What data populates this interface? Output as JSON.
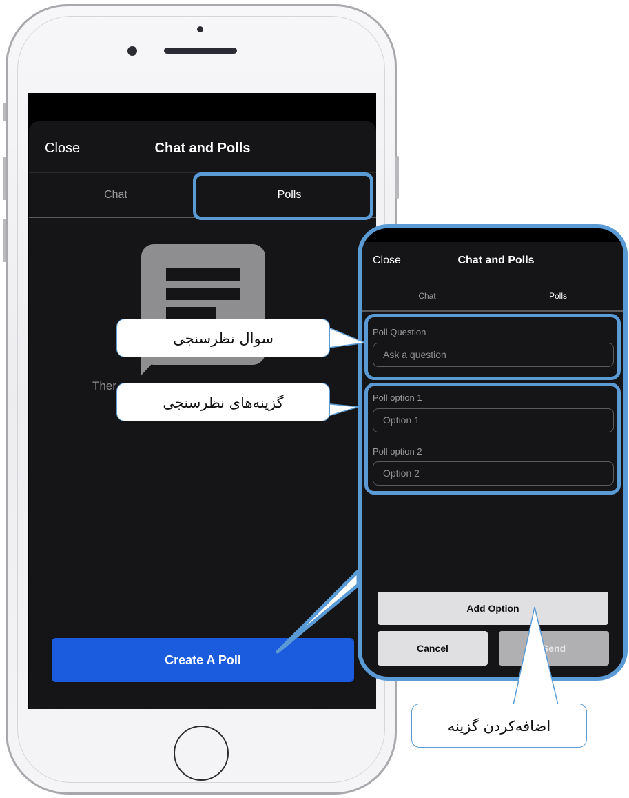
{
  "screen": {
    "header": {
      "close_label": "Close",
      "title": "Chat and Polls"
    },
    "tabs": [
      {
        "label": "Chat"
      },
      {
        "label": "Polls"
      }
    ],
    "empty_state": {
      "text_fragment": "Ther"
    },
    "create_poll_label": "Create A Poll"
  },
  "zoom": {
    "header": {
      "close_label": "Close",
      "title": "Chat and Polls"
    },
    "tabs": [
      {
        "label": "Chat"
      },
      {
        "label": "Polls"
      }
    ],
    "poll_question": {
      "label": "Poll Question",
      "placeholder": "Ask a question"
    },
    "options": [
      {
        "label": "Poll option 1",
        "placeholder": "Option 1"
      },
      {
        "label": "Poll option 2",
        "placeholder": "Option 2"
      }
    ],
    "buttons": {
      "add_option": "Add Option",
      "cancel": "Cancel",
      "send": "Send"
    }
  },
  "callouts": {
    "poll_question": "سوال نظرسنجی",
    "poll_options": "گزینه‌های  نظرسنجی",
    "add_option": "اضافه‌کردن گزینه"
  },
  "colors": {
    "accent_blue": "#1b5bde",
    "highlight_blue": "#5b9bd5",
    "sheet_bg": "#151517"
  }
}
